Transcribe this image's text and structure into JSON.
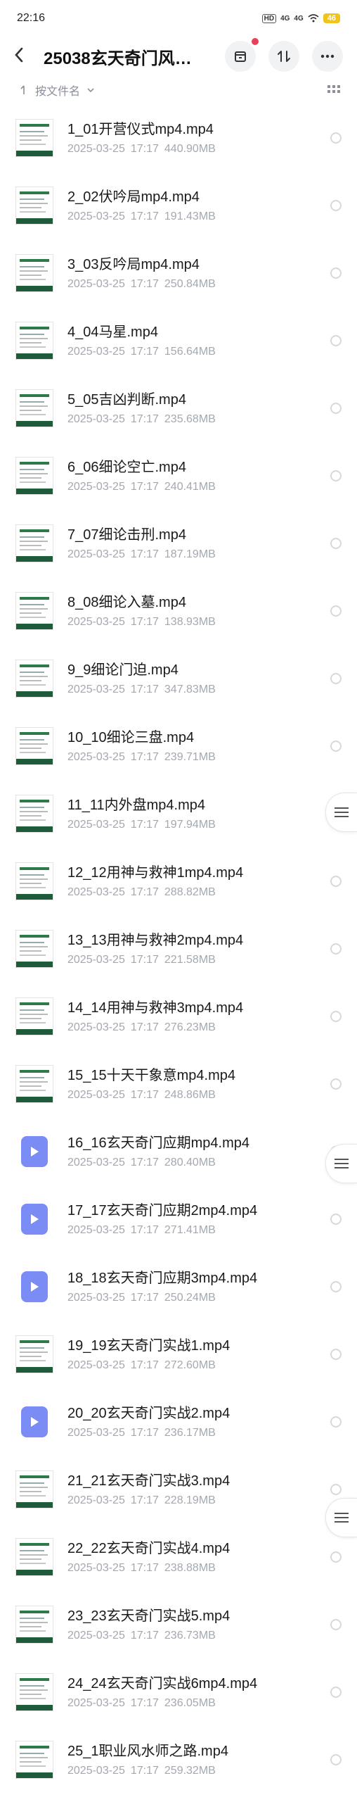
{
  "status": {
    "time": "22:16",
    "hd": "HD",
    "net1": "4G",
    "net2": "4G",
    "battery": "46"
  },
  "header": {
    "title": "25038玄天奇门风…"
  },
  "sort": {
    "label": "按文件名"
  },
  "files": [
    {
      "name": "1_01开营仪式mp4.mp4",
      "date": "2025-03-25",
      "time": "17:17",
      "size": "440.90MB",
      "thumb": "slide"
    },
    {
      "name": "2_02伏吟局mp4.mp4",
      "date": "2025-03-25",
      "time": "17:17",
      "size": "191.43MB",
      "thumb": "slide"
    },
    {
      "name": "3_03反吟局mp4.mp4",
      "date": "2025-03-25",
      "time": "17:17",
      "size": "250.84MB",
      "thumb": "slide"
    },
    {
      "name": "4_04马星.mp4",
      "date": "2025-03-25",
      "time": "17:17",
      "size": "156.64MB",
      "thumb": "slide"
    },
    {
      "name": "5_05吉凶判断.mp4",
      "date": "2025-03-25",
      "time": "17:17",
      "size": "235.68MB",
      "thumb": "slide"
    },
    {
      "name": "6_06细论空亡.mp4",
      "date": "2025-03-25",
      "time": "17:17",
      "size": "240.41MB",
      "thumb": "slide"
    },
    {
      "name": "7_07细论击刑.mp4",
      "date": "2025-03-25",
      "time": "17:17",
      "size": "187.19MB",
      "thumb": "slide"
    },
    {
      "name": "8_08细论入墓.mp4",
      "date": "2025-03-25",
      "time": "17:17",
      "size": "138.93MB",
      "thumb": "slide"
    },
    {
      "name": "9_9细论门迫.mp4",
      "date": "2025-03-25",
      "time": "17:17",
      "size": "347.83MB",
      "thumb": "slide"
    },
    {
      "name": "10_10细论三盘.mp4",
      "date": "2025-03-25",
      "time": "17:17",
      "size": "239.71MB",
      "thumb": "slide"
    },
    {
      "name": "11_11内外盘mp4.mp4",
      "date": "2025-03-25",
      "time": "17:17",
      "size": "197.94MB",
      "thumb": "slide"
    },
    {
      "name": "12_12用神与救神1mp4.mp4",
      "date": "2025-03-25",
      "time": "17:17",
      "size": "288.82MB",
      "thumb": "slide"
    },
    {
      "name": "13_13用神与救神2mp4.mp4",
      "date": "2025-03-25",
      "time": "17:17",
      "size": "221.58MB",
      "thumb": "slide"
    },
    {
      "name": "14_14用神与救神3mp4.mp4",
      "date": "2025-03-25",
      "time": "17:17",
      "size": "276.23MB",
      "thumb": "slide"
    },
    {
      "name": "15_15十天干象意mp4.mp4",
      "date": "2025-03-25",
      "time": "17:17",
      "size": "248.86MB",
      "thumb": "slide"
    },
    {
      "name": "16_16玄天奇门应期mp4.mp4",
      "date": "2025-03-25",
      "time": "17:17",
      "size": "280.40MB",
      "thumb": "video"
    },
    {
      "name": "17_17玄天奇门应期2mp4.mp4",
      "date": "2025-03-25",
      "time": "17:17",
      "size": "271.41MB",
      "thumb": "video"
    },
    {
      "name": "18_18玄天奇门应期3mp4.mp4",
      "date": "2025-03-25",
      "time": "17:17",
      "size": "250.24MB",
      "thumb": "video"
    },
    {
      "name": "19_19玄天奇门实战1.mp4",
      "date": "2025-03-25",
      "time": "17:17",
      "size": "272.60MB",
      "thumb": "slide"
    },
    {
      "name": "20_20玄天奇门实战2.mp4",
      "date": "2025-03-25",
      "time": "17:17",
      "size": "236.17MB",
      "thumb": "video"
    },
    {
      "name": "21_21玄天奇门实战3.mp4",
      "date": "2025-03-25",
      "time": "17:17",
      "size": "228.19MB",
      "thumb": "slide"
    },
    {
      "name": "22_22玄天奇门实战4.mp4",
      "date": "2025-03-25",
      "time": "17:17",
      "size": "238.88MB",
      "thumb": "slide"
    },
    {
      "name": "23_23玄天奇门实战5.mp4",
      "date": "2025-03-25",
      "time": "17:17",
      "size": "236.73MB",
      "thumb": "slide"
    },
    {
      "name": "24_24玄天奇门实战6mp4.mp4",
      "date": "2025-03-25",
      "time": "17:17",
      "size": "236.05MB",
      "thumb": "slide"
    },
    {
      "name": "25_1职业风水师之路.mp4",
      "date": "2025-03-25",
      "time": "17:17",
      "size": "259.32MB",
      "thumb": "slide"
    }
  ],
  "colors": {
    "accent_video": "#7b8cf4",
    "slide_green": "#1f5d3a",
    "notification": "#e8415a"
  }
}
